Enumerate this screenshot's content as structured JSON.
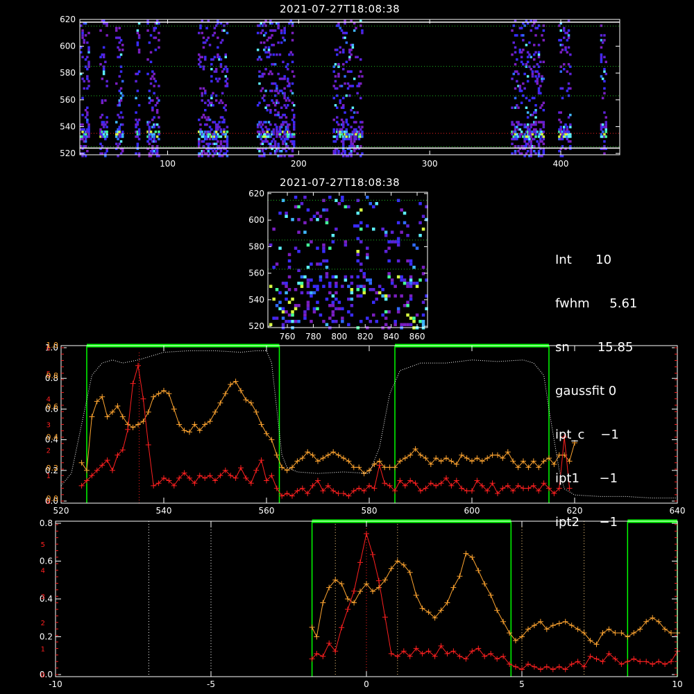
{
  "titles": {
    "top": "2021-07-27T18:08:38",
    "middle": "2021-07-27T18:08:38"
  },
  "info": [
    {
      "key": "Int",
      "val": "10"
    },
    {
      "key": "fwhm",
      "val": "5.61"
    },
    {
      "key": "sn",
      "val": "15.85"
    },
    {
      "key": "gaussfit",
      "val": "0"
    },
    {
      "key": "ipt_c",
      "val": "−1"
    },
    {
      "key": "ipt1",
      "val": "−1"
    },
    {
      "key": "ipt2",
      "val": "−1"
    }
  ],
  "colors": {
    "background": "#000000",
    "axes": "#ffffff",
    "orange": "#ffa530",
    "red": "#ff2020",
    "green": "#00ff00",
    "green_dotted": "#1fbf1f",
    "white_dotted": "#ffffff",
    "dotted_orange": "#ffd080"
  },
  "chart_data": [
    {
      "type": "heatmap",
      "title": "2021-07-27T18:08:38",
      "xlim": [
        33,
        445
      ],
      "ylim": [
        519,
        620
      ],
      "xticks": [
        100,
        200,
        300,
        400
      ],
      "yticks": [
        520,
        540,
        560,
        580,
        600,
        620
      ],
      "y_guide_lines_green": [
        615,
        585,
        563,
        525
      ],
      "y_guide_lines_red": [
        535
      ],
      "y_guide_lines_white": [
        618,
        524
      ],
      "active_x_bands": [
        [
          33,
          40
        ],
        [
          48,
          53
        ],
        [
          60,
          66
        ],
        [
          75,
          78
        ],
        [
          84,
          93
        ],
        [
          123,
          145
        ],
        [
          168,
          196
        ],
        [
          226,
          248
        ],
        [
          362,
          386
        ],
        [
          398,
          407
        ],
        [
          430,
          434
        ]
      ],
      "hot_row": 535
    },
    {
      "type": "heatmap",
      "title": "2021-07-27T18:08:38",
      "xlim": [
        745,
        868
      ],
      "ylim": [
        519,
        621
      ],
      "xticks": [
        760,
        780,
        800,
        820,
        840,
        860
      ],
      "yticks": [
        520,
        540,
        560,
        580,
        600,
        620
      ],
      "y_guide_lines_green": [
        615,
        585,
        563
      ]
    },
    {
      "type": "line",
      "xlim": [
        520,
        640
      ],
      "xticks": [
        520,
        540,
        560,
        580,
        600,
        620,
        640
      ],
      "y_left_white_ticks": [
        0.0,
        0.2,
        0.4,
        0.6,
        0.8,
        1.0
      ],
      "y_left_red_ticks": [
        0,
        1,
        2,
        3,
        4,
        5,
        6
      ],
      "y_left_orange_ticks": [
        0.0,
        0.2,
        0.4,
        0.6,
        0.8,
        1.0
      ],
      "green_windows": [
        [
          525,
          562.5
        ],
        [
          585,
          615
        ]
      ],
      "red_marker_x": 535.2,
      "series": [
        {
          "color": "orange",
          "x": [
            524,
            525,
            526,
            527,
            528,
            529,
            530,
            531,
            532,
            533,
            534,
            535,
            536,
            537,
            538,
            539,
            540,
            541,
            542,
            543,
            544,
            545,
            546,
            547,
            548,
            549,
            550,
            551,
            552,
            553,
            554,
            555,
            556,
            557,
            558,
            559,
            560,
            561,
            562,
            563,
            564,
            565,
            566,
            567,
            568,
            569,
            570,
            571,
            572,
            573,
            574,
            575,
            576,
            577,
            578,
            579,
            580,
            581,
            582,
            583,
            584,
            585,
            586,
            587,
            588,
            589,
            590,
            591,
            592,
            593,
            594,
            595,
            596,
            597,
            598,
            599,
            600,
            601,
            602,
            603,
            604,
            605,
            606,
            607,
            608,
            609,
            610,
            611,
            612,
            613,
            614,
            615,
            616,
            617,
            618,
            619,
            620
          ],
          "y": [
            0.25,
            0.2,
            0.55,
            0.65,
            0.68,
            0.55,
            0.58,
            0.62,
            0.55,
            0.5,
            0.48,
            0.5,
            0.52,
            0.58,
            0.68,
            0.7,
            0.72,
            0.7,
            0.6,
            0.5,
            0.46,
            0.45,
            0.5,
            0.46,
            0.5,
            0.52,
            0.58,
            0.64,
            0.7,
            0.76,
            0.78,
            0.72,
            0.66,
            0.64,
            0.58,
            0.5,
            0.44,
            0.4,
            0.3,
            0.22,
            0.2,
            0.22,
            0.26,
            0.28,
            0.32,
            0.3,
            0.26,
            0.28,
            0.3,
            0.32,
            0.3,
            0.28,
            0.26,
            0.22,
            0.22,
            0.18,
            0.2,
            0.24,
            0.26,
            0.22,
            0.22,
            0.22,
            0.26,
            0.28,
            0.3,
            0.34,
            0.3,
            0.28,
            0.24,
            0.28,
            0.26,
            0.28,
            0.26,
            0.24,
            0.3,
            0.28,
            0.26,
            0.28,
            0.26,
            0.28,
            0.3,
            0.3,
            0.28,
            0.32,
            0.26,
            0.22,
            0.26,
            0.22,
            0.26,
            0.22,
            0.26,
            0.28,
            0.24,
            0.3,
            0.3,
            0.26,
            0.38
          ]
        },
        {
          "color": "red",
          "x": [
            524,
            525,
            526,
            527,
            528,
            529,
            530,
            531,
            532,
            533,
            534,
            535,
            536,
            537,
            538,
            539,
            540,
            541,
            542,
            543,
            544,
            545,
            546,
            547,
            548,
            549,
            550,
            551,
            552,
            553,
            554,
            555,
            556,
            557,
            558,
            559,
            560,
            561,
            562,
            563,
            564,
            565,
            566,
            567,
            568,
            569,
            570,
            571,
            572,
            573,
            574,
            575,
            576,
            577,
            578,
            579,
            580,
            581,
            582,
            583,
            584,
            585,
            586,
            587,
            588,
            589,
            590,
            591,
            592,
            593,
            594,
            595,
            596,
            597,
            598,
            599,
            600,
            601,
            602,
            603,
            604,
            605,
            606,
            607,
            608,
            609,
            610,
            611,
            612,
            613,
            614,
            615,
            616,
            617,
            618,
            619
          ],
          "y": [
            0.6,
            0.8,
            1.0,
            1.2,
            1.4,
            1.6,
            1.2,
            1.8,
            2.0,
            2.8,
            4.6,
            5.3,
            4.0,
            2.2,
            0.6,
            0.7,
            0.9,
            0.8,
            0.6,
            0.9,
            1.1,
            0.9,
            0.7,
            1.0,
            0.9,
            1.0,
            0.8,
            1.0,
            1.2,
            1.0,
            0.9,
            1.3,
            0.9,
            0.7,
            1.2,
            1.6,
            0.8,
            1.0,
            0.5,
            0.2,
            0.3,
            0.2,
            0.4,
            0.5,
            0.3,
            0.6,
            0.8,
            0.4,
            0.6,
            0.4,
            0.3,
            0.3,
            0.2,
            0.4,
            0.5,
            0.4,
            0.6,
            0.5,
            1.4,
            0.7,
            0.6,
            0.4,
            0.8,
            0.6,
            0.8,
            0.7,
            0.4,
            0.5,
            0.7,
            0.6,
            0.7,
            0.9,
            0.6,
            0.8,
            0.5,
            0.4,
            0.4,
            0.8,
            0.6,
            0.4,
            0.7,
            0.3,
            0.5,
            0.6,
            0.4,
            0.6,
            0.5,
            0.5,
            0.6,
            0.4,
            0.7,
            0.5,
            0.3,
            0.5,
            2.5,
            0.5
          ]
        },
        {
          "color": "white_dotted",
          "x": [
            520,
            522,
            524,
            526,
            528,
            530,
            532,
            535,
            540,
            545,
            550,
            555,
            558,
            560,
            561,
            562,
            563,
            564,
            566,
            570,
            575,
            580,
            582,
            584,
            586,
            590,
            595,
            600,
            605,
            610,
            612,
            614,
            615,
            616,
            617,
            618,
            620,
            625,
            630,
            635,
            640
          ],
          "y": [
            0.1,
            0.18,
            0.5,
            0.82,
            0.9,
            0.92,
            0.9,
            0.92,
            0.97,
            0.98,
            0.98,
            0.97,
            0.98,
            0.98,
            0.9,
            0.6,
            0.3,
            0.22,
            0.19,
            0.18,
            0.19,
            0.18,
            0.35,
            0.7,
            0.85,
            0.9,
            0.9,
            0.92,
            0.91,
            0.92,
            0.9,
            0.82,
            0.6,
            0.4,
            0.2,
            0.08,
            0.04,
            0.03,
            0.03,
            0.02,
            0.02
          ]
        }
      ]
    },
    {
      "type": "line",
      "xlim": [
        -10,
        10
      ],
      "xticks": [
        -10,
        -5,
        0,
        5,
        10
      ],
      "y_left_white_ticks": [
        0.0,
        0.2,
        0.4,
        0.6,
        0.8
      ],
      "y_left_red_ticks": [
        0,
        1,
        2,
        3,
        4,
        5
      ],
      "green_windows": [
        [
          -1.75,
          4.65
        ],
        [
          8.4,
          10
        ]
      ],
      "white_dotted_x": [
        -7,
        -5
      ],
      "yellow_dotted_x": [
        -1,
        1,
        5,
        7
      ],
      "red_marker_x": 0,
      "series": [
        {
          "color": "orange",
          "x": [
            -1.75,
            -1.6,
            -1.4,
            -1.2,
            -1.0,
            -0.8,
            -0.6,
            -0.4,
            -0.2,
            0.0,
            0.2,
            0.4,
            0.6,
            0.8,
            1.0,
            1.2,
            1.4,
            1.6,
            1.8,
            2.0,
            2.2,
            2.4,
            2.6,
            2.8,
            3.0,
            3.2,
            3.4,
            3.6,
            3.8,
            4.0,
            4.2,
            4.4,
            4.6,
            4.8,
            5.0,
            5.2,
            5.4,
            5.6,
            5.8,
            6.0,
            6.2,
            6.4,
            6.6,
            6.8,
            7.0,
            7.2,
            7.4,
            7.6,
            7.8,
            8.0,
            8.2,
            8.4,
            8.6,
            8.8,
            9.0,
            9.2,
            9.4,
            9.6,
            9.8,
            10.0
          ],
          "y": [
            0.25,
            0.2,
            0.38,
            0.46,
            0.5,
            0.48,
            0.4,
            0.38,
            0.44,
            0.48,
            0.44,
            0.46,
            0.5,
            0.56,
            0.6,
            0.58,
            0.54,
            0.42,
            0.35,
            0.33,
            0.3,
            0.34,
            0.38,
            0.46,
            0.52,
            0.64,
            0.62,
            0.55,
            0.48,
            0.42,
            0.34,
            0.28,
            0.22,
            0.18,
            0.2,
            0.24,
            0.26,
            0.28,
            0.24,
            0.26,
            0.27,
            0.28,
            0.26,
            0.24,
            0.22,
            0.18,
            0.16,
            0.22,
            0.24,
            0.22,
            0.22,
            0.2,
            0.22,
            0.24,
            0.28,
            0.3,
            0.28,
            0.24,
            0.22,
            0.22
          ]
        },
        {
          "color": "red",
          "x": [
            -1.75,
            -1.6,
            -1.4,
            -1.2,
            -1.0,
            -0.8,
            -0.6,
            -0.4,
            -0.2,
            0.0,
            0.2,
            0.4,
            0.6,
            0.8,
            1.0,
            1.2,
            1.4,
            1.6,
            1.8,
            2.0,
            2.2,
            2.4,
            2.6,
            2.8,
            3.0,
            3.2,
            3.4,
            3.6,
            3.8,
            4.0,
            4.2,
            4.4,
            4.6,
            4.8,
            5.0,
            5.2,
            5.4,
            5.6,
            5.8,
            6.0,
            6.2,
            6.4,
            6.6,
            6.8,
            7.0,
            7.2,
            7.4,
            7.6,
            7.8,
            8.0,
            8.2,
            8.4,
            8.6,
            8.8,
            9.0,
            9.2,
            9.4,
            9.6,
            9.8,
            10.0
          ],
          "y": [
            0.6,
            0.8,
            0.7,
            1.2,
            0.9,
            1.8,
            2.5,
            3.2,
            4.3,
            5.4,
            4.6,
            3.6,
            2.2,
            0.8,
            0.7,
            0.9,
            0.7,
            1.0,
            0.8,
            0.9,
            0.7,
            1.1,
            0.8,
            0.9,
            0.7,
            0.6,
            0.9,
            1.0,
            0.7,
            0.8,
            0.6,
            0.7,
            0.4,
            0.3,
            0.2,
            0.4,
            0.3,
            0.2,
            0.3,
            0.2,
            0.3,
            0.2,
            0.4,
            0.5,
            0.3,
            0.7,
            0.6,
            0.5,
            0.8,
            0.6,
            0.4,
            0.5,
            0.6,
            0.5,
            0.5,
            0.4,
            0.5,
            0.4,
            0.5,
            0.9
          ]
        }
      ]
    }
  ]
}
